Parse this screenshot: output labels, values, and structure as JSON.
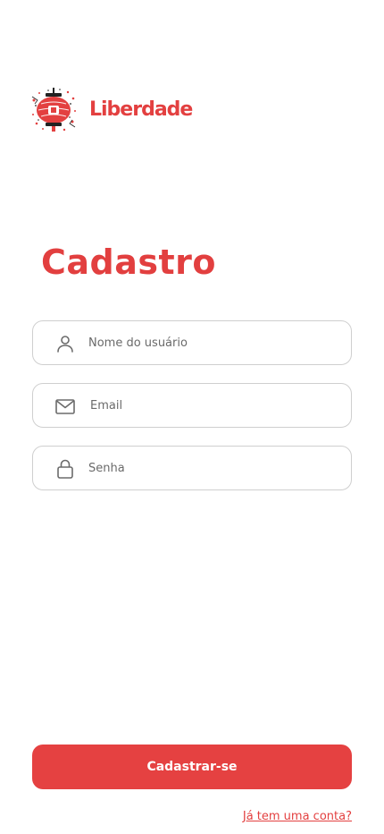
{
  "brand": {
    "name": "Liberdade",
    "logo_icon": "lantern-logo-icon",
    "color": "#e34040"
  },
  "form": {
    "title": "Cadastro",
    "fields": [
      {
        "icon": "user-icon",
        "placeholder": "Nome do usuário",
        "type": "text"
      },
      {
        "icon": "mail-icon",
        "placeholder": "Email",
        "type": "email"
      },
      {
        "icon": "lock-icon",
        "placeholder": "Senha",
        "type": "password"
      }
    ],
    "submit_label": "Cadastrar-se",
    "login_link": "Já tem uma conta?"
  },
  "colors": {
    "accent": "#e54141",
    "border": "#cfcfcf",
    "icon": "#6b6b6b"
  }
}
